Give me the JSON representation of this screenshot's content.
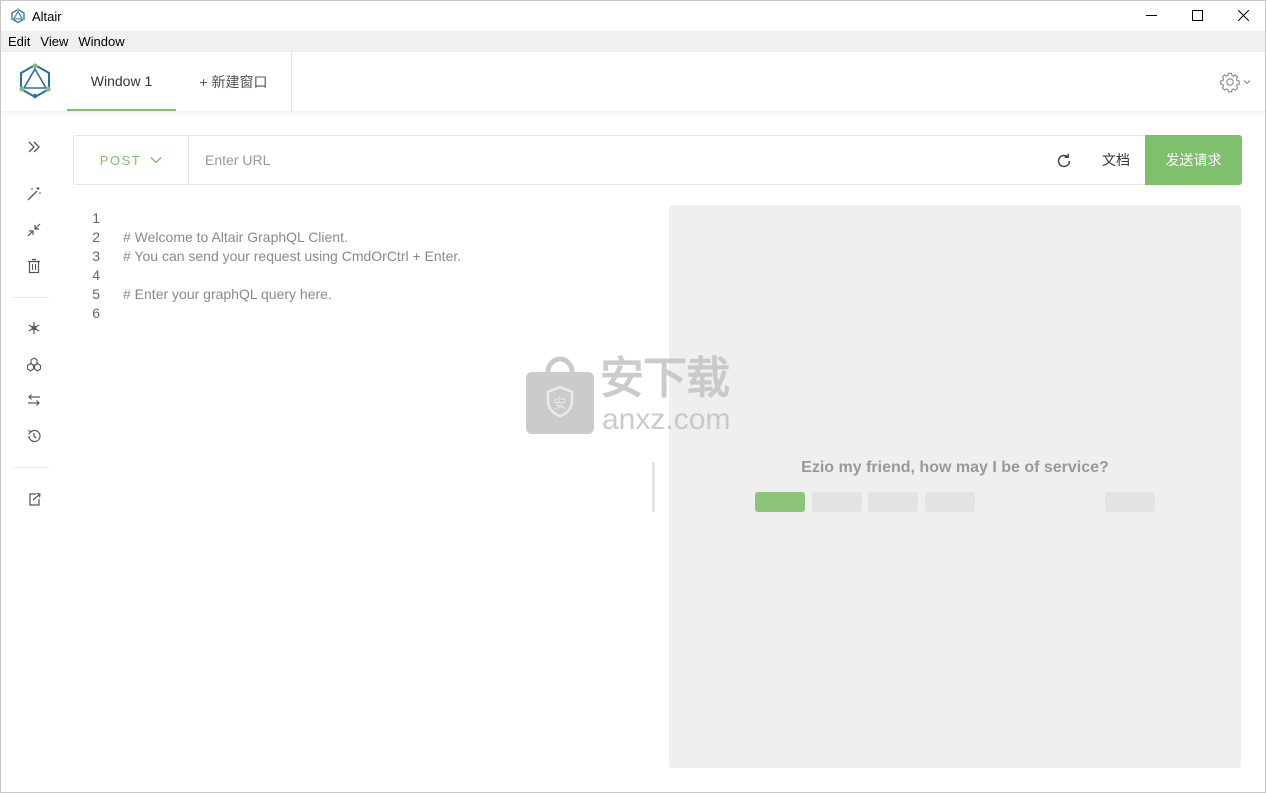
{
  "window": {
    "title": "Altair",
    "controls": [
      "minimize-icon",
      "maximize-icon",
      "close-icon"
    ]
  },
  "menu": {
    "items": [
      {
        "label": "Edit"
      },
      {
        "label": "View"
      },
      {
        "label": "Window"
      }
    ]
  },
  "header": {
    "tabs": [
      {
        "label": "Window 1",
        "active": true
      }
    ],
    "new_tab_label": "+ 新建窗口",
    "settings_icon": "gear-icon"
  },
  "sidebar": {
    "icons": [
      "expand-icon",
      "prettify-wand-icon",
      "compress-icon",
      "trash-icon",
      "variables-icon",
      "subscriptions-icon",
      "switch-icon",
      "history-icon",
      "export-icon"
    ]
  },
  "request": {
    "method": "POST",
    "url": "",
    "url_placeholder": "Enter URL",
    "docs_label": "文档",
    "send_label": "发送请求"
  },
  "editor": {
    "lines": [
      {
        "n": "1",
        "text": ""
      },
      {
        "n": "2",
        "text": "# Welcome to Altair GraphQL Client."
      },
      {
        "n": "3",
        "text": "# You can send your request using CmdOrCtrl + Enter."
      },
      {
        "n": "4",
        "text": ""
      },
      {
        "n": "5",
        "text": "# Enter your graphQL query here."
      },
      {
        "n": "6",
        "text": ""
      }
    ]
  },
  "result": {
    "greeting": "Ezio my friend, how may I be of service?"
  },
  "watermark": {
    "cn": "安下载",
    "en": "anxz.com"
  },
  "colors": {
    "accent": "#7ec06c",
    "result_bg": "#efefef"
  }
}
